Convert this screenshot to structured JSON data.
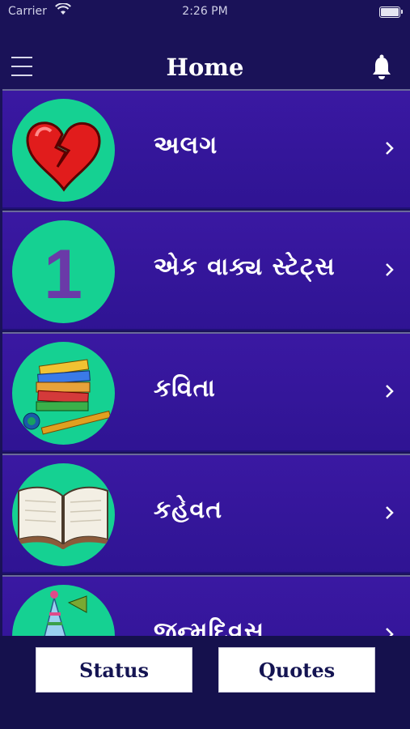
{
  "status_bar": {
    "carrier": "Carrier",
    "time": "2:26 PM",
    "wifi_icon": "wifi-icon",
    "battery_icon": "battery-icon"
  },
  "navbar": {
    "title": "Home",
    "menu_icon": "hamburger-menu-icon",
    "bell_icon": "bell-icon"
  },
  "categories": [
    {
      "label": "અલગ",
      "icon": "broken-heart-icon"
    },
    {
      "label": "એક વાક્ય સ્ટેટ્સ",
      "icon": "number-one-icon",
      "icon_text": "1"
    },
    {
      "label": "કવિતા",
      "icon": "books-flute-icon"
    },
    {
      "label": "કહેવત",
      "icon": "open-book-icon"
    },
    {
      "label": "જન્મદિવસ",
      "icon": "birthday-icon"
    }
  ],
  "bottom_bar": {
    "status_label": "Status",
    "quotes_label": "Quotes"
  },
  "colors": {
    "background": "#1a1258",
    "row": "#3a18a2",
    "circle": "#15d192",
    "number": "#6a3aa8"
  }
}
